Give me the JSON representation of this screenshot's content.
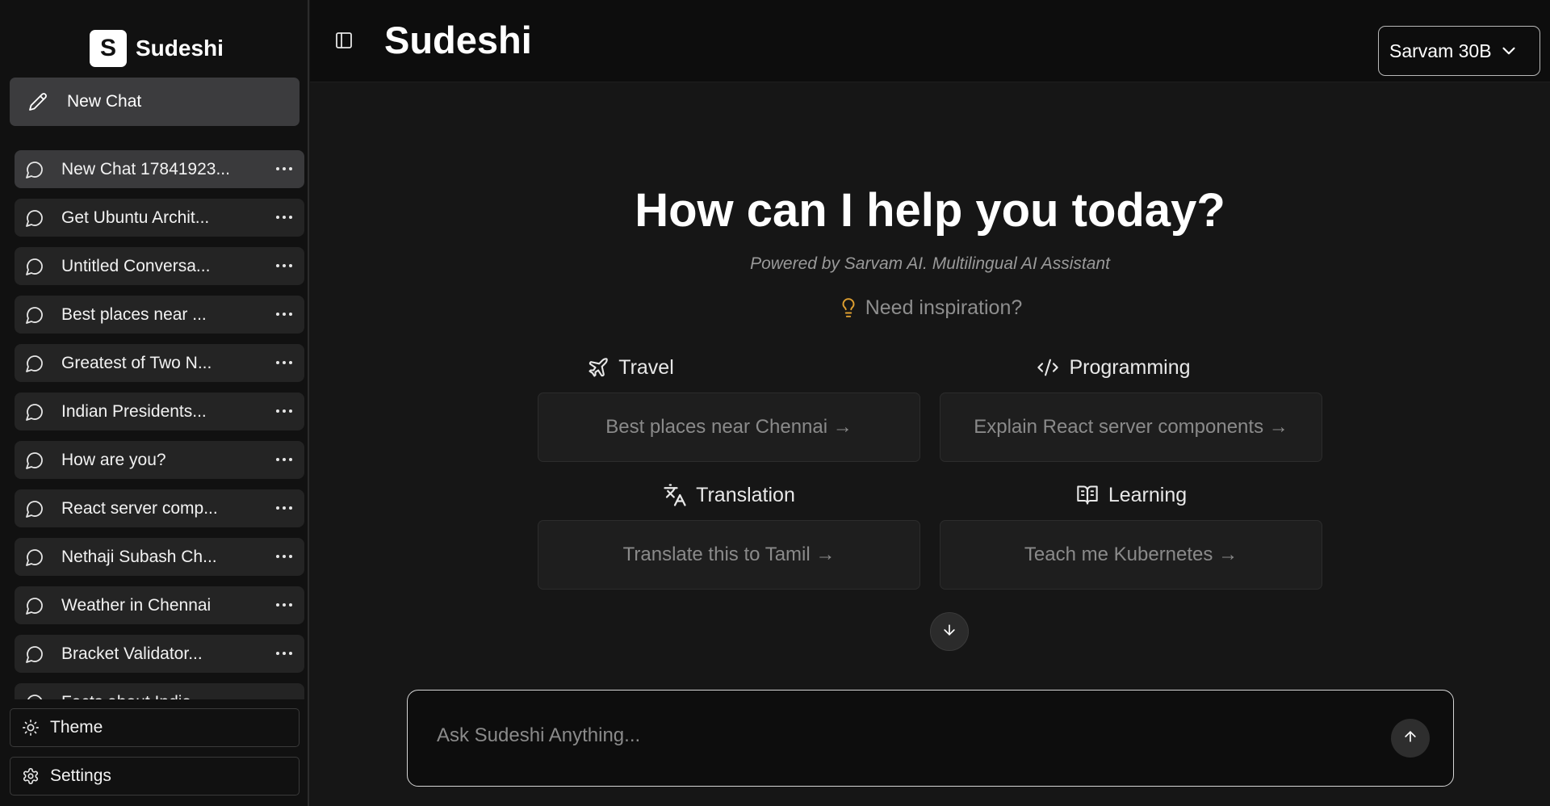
{
  "app": {
    "brand_letter": "S",
    "brand_name": "Sudeshi"
  },
  "sidebar": {
    "new_chat_label": "New Chat",
    "chats": [
      {
        "title": "New Chat 17841923...",
        "active": true
      },
      {
        "title": "Get Ubuntu Archit...",
        "active": false
      },
      {
        "title": "Untitled Conversa...",
        "active": false
      },
      {
        "title": "Best places near ...",
        "active": false
      },
      {
        "title": "Greatest of Two N...",
        "active": false
      },
      {
        "title": "Indian Presidents...",
        "active": false
      },
      {
        "title": "How are you?",
        "active": false
      },
      {
        "title": "React server comp...",
        "active": false
      },
      {
        "title": "Nethaji Subash Ch...",
        "active": false
      },
      {
        "title": "Weather in Chennai",
        "active": false
      },
      {
        "title": "Bracket Validator...",
        "active": false
      },
      {
        "title": "Facts about India",
        "active": false
      }
    ],
    "theme_label": "Theme",
    "settings_label": "Settings"
  },
  "header": {
    "title": "Sudeshi",
    "model": "Sarvam 30B"
  },
  "main": {
    "heading": "How can I help you today?",
    "subtitle": "Powered by Sarvam AI. Multilingual AI Assistant",
    "inspiration_label": "Need inspiration?",
    "categories": [
      {
        "label": "Travel",
        "icon": "plane-icon",
        "prompt": "Best places near Chennai →"
      },
      {
        "label": "Programming",
        "icon": "code-icon",
        "prompt": "Explain React server components →"
      },
      {
        "label": "Translation",
        "icon": "languages-icon",
        "prompt": "Translate this to Tamil →"
      },
      {
        "label": "Learning",
        "icon": "book-open-icon",
        "prompt": "Teach me Kubernetes →"
      }
    ]
  },
  "composer": {
    "placeholder": "Ask Sudeshi Anything..."
  },
  "colors": {
    "background": "#161616",
    "sidebar": "#111111",
    "accent_bulb": "#e0a030",
    "active_item": "#3a3a3c"
  }
}
